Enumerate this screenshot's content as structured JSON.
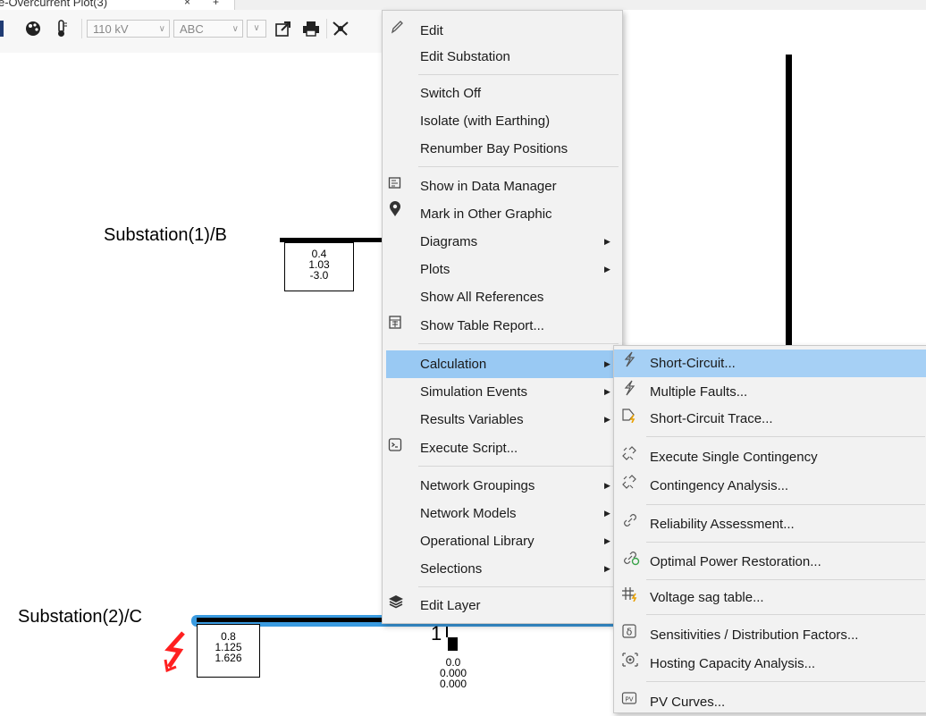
{
  "tab": {
    "title": "e-Overcurrent Plot(3)",
    "close": "×",
    "add": "+"
  },
  "toolbar": {
    "icons": [
      "cursor-icon",
      "palette-icon",
      "thermometer-icon"
    ],
    "voltage_select": "110 kV",
    "phase_select": "ABC",
    "export_icon": "export-icon",
    "print_icon": "print-icon",
    "network_icon": "network-icon"
  },
  "diagram": {
    "bus1": {
      "label": "Substation(1)/B",
      "values": [
        "0.4",
        "1.03",
        "-3.0"
      ]
    },
    "bus2": {
      "label": "Substation(2)/C",
      "values": [
        "0.8",
        "1.125",
        "1.626"
      ]
    },
    "node": {
      "label": "1",
      "values": [
        "0.0",
        "0.000",
        "0.000"
      ]
    },
    "fault_color": "#ff2020",
    "bus_highlight_color": "#3a9be0"
  },
  "context_menu": {
    "items": [
      {
        "label": "Edit",
        "icon": "pencil-icon"
      },
      {
        "label": "Edit Substation"
      },
      {
        "label": "Switch Off"
      },
      {
        "label": "Isolate (with Earthing)"
      },
      {
        "label": "Renumber Bay Positions"
      },
      {
        "label": "Show in Data Manager",
        "icon": "data-manager-icon"
      },
      {
        "label": "Mark in Other Graphic",
        "icon": "location-pin-icon"
      },
      {
        "label": "Diagrams",
        "submenu": true
      },
      {
        "label": "Plots",
        "submenu": true
      },
      {
        "label": "Show All References"
      },
      {
        "label": "Show Table Report...",
        "icon": "table-report-icon"
      },
      {
        "label": "Calculation",
        "submenu": true,
        "highlighted": true
      },
      {
        "label": "Simulation Events",
        "submenu": true
      },
      {
        "label": "Results Variables",
        "submenu": true
      },
      {
        "label": "Execute Script...",
        "icon": "script-icon"
      },
      {
        "label": "Network Groupings",
        "submenu": true
      },
      {
        "label": "Network Models",
        "submenu": true
      },
      {
        "label": "Operational Library",
        "submenu": true
      },
      {
        "label": "Selections",
        "submenu": true
      },
      {
        "label": "Edit Layer",
        "icon": "layers-icon"
      }
    ]
  },
  "submenu": {
    "items": [
      {
        "label": "Short-Circuit...",
        "icon": "lightning-icon",
        "highlighted": true
      },
      {
        "label": "Multiple Faults...",
        "icon": "lightning-icon"
      },
      {
        "label": "Short-Circuit Trace...",
        "icon": "trace-icon"
      },
      {
        "label": "Execute Single Contingency",
        "icon": "broken-link-icon"
      },
      {
        "label": "Contingency Analysis...",
        "icon": "broken-link-icon"
      },
      {
        "label": "Reliability Assessment...",
        "icon": "link-icon"
      },
      {
        "label": "Optimal Power Restoration...",
        "icon": "link-restore-icon"
      },
      {
        "label": "Voltage sag table...",
        "icon": "sag-table-icon"
      },
      {
        "label": "Sensitivities / Distribution Factors...",
        "icon": "delta-icon"
      },
      {
        "label": "Hosting Capacity Analysis...",
        "icon": "hosting-icon"
      },
      {
        "label": "PV Curves...",
        "icon": "pv-icon"
      }
    ]
  }
}
